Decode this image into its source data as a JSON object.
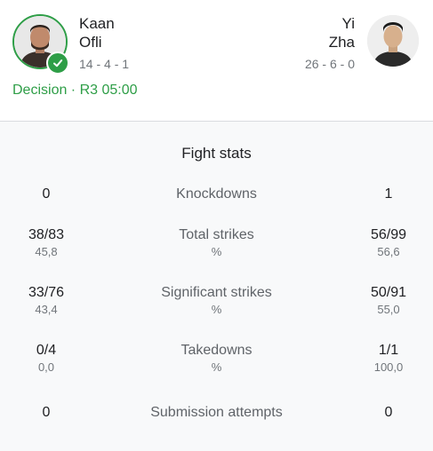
{
  "fighter_left": {
    "first_name": "Kaan",
    "last_name": "Ofli",
    "record": "14 - 4 - 1",
    "winner": true
  },
  "fighter_right": {
    "first_name": "Yi",
    "last_name": "Zha",
    "record": "26 - 6 - 0"
  },
  "result": "Decision · R3 05:00",
  "stats": {
    "title": "Fight stats",
    "rows": [
      {
        "label": "Knockdowns",
        "left": "0",
        "right": "1"
      },
      {
        "label": "Total strikes",
        "left": "38/83",
        "right": "56/99",
        "sub_label": "%",
        "left_sub": "45,8",
        "right_sub": "56,6"
      },
      {
        "label": "Significant strikes",
        "left": "33/76",
        "right": "50/91",
        "sub_label": "%",
        "left_sub": "43,4",
        "right_sub": "55,0"
      },
      {
        "label": "Takedowns",
        "left": "0/4",
        "right": "1/1",
        "sub_label": "%",
        "left_sub": "0,0",
        "right_sub": "100,0"
      },
      {
        "label": "Submission attempts",
        "left": "0",
        "right": "0"
      }
    ]
  },
  "colors": {
    "winner_green": "#2e9e47",
    "text": "#202124",
    "muted": "#70757a",
    "panel_bg": "#f8f9fa"
  }
}
